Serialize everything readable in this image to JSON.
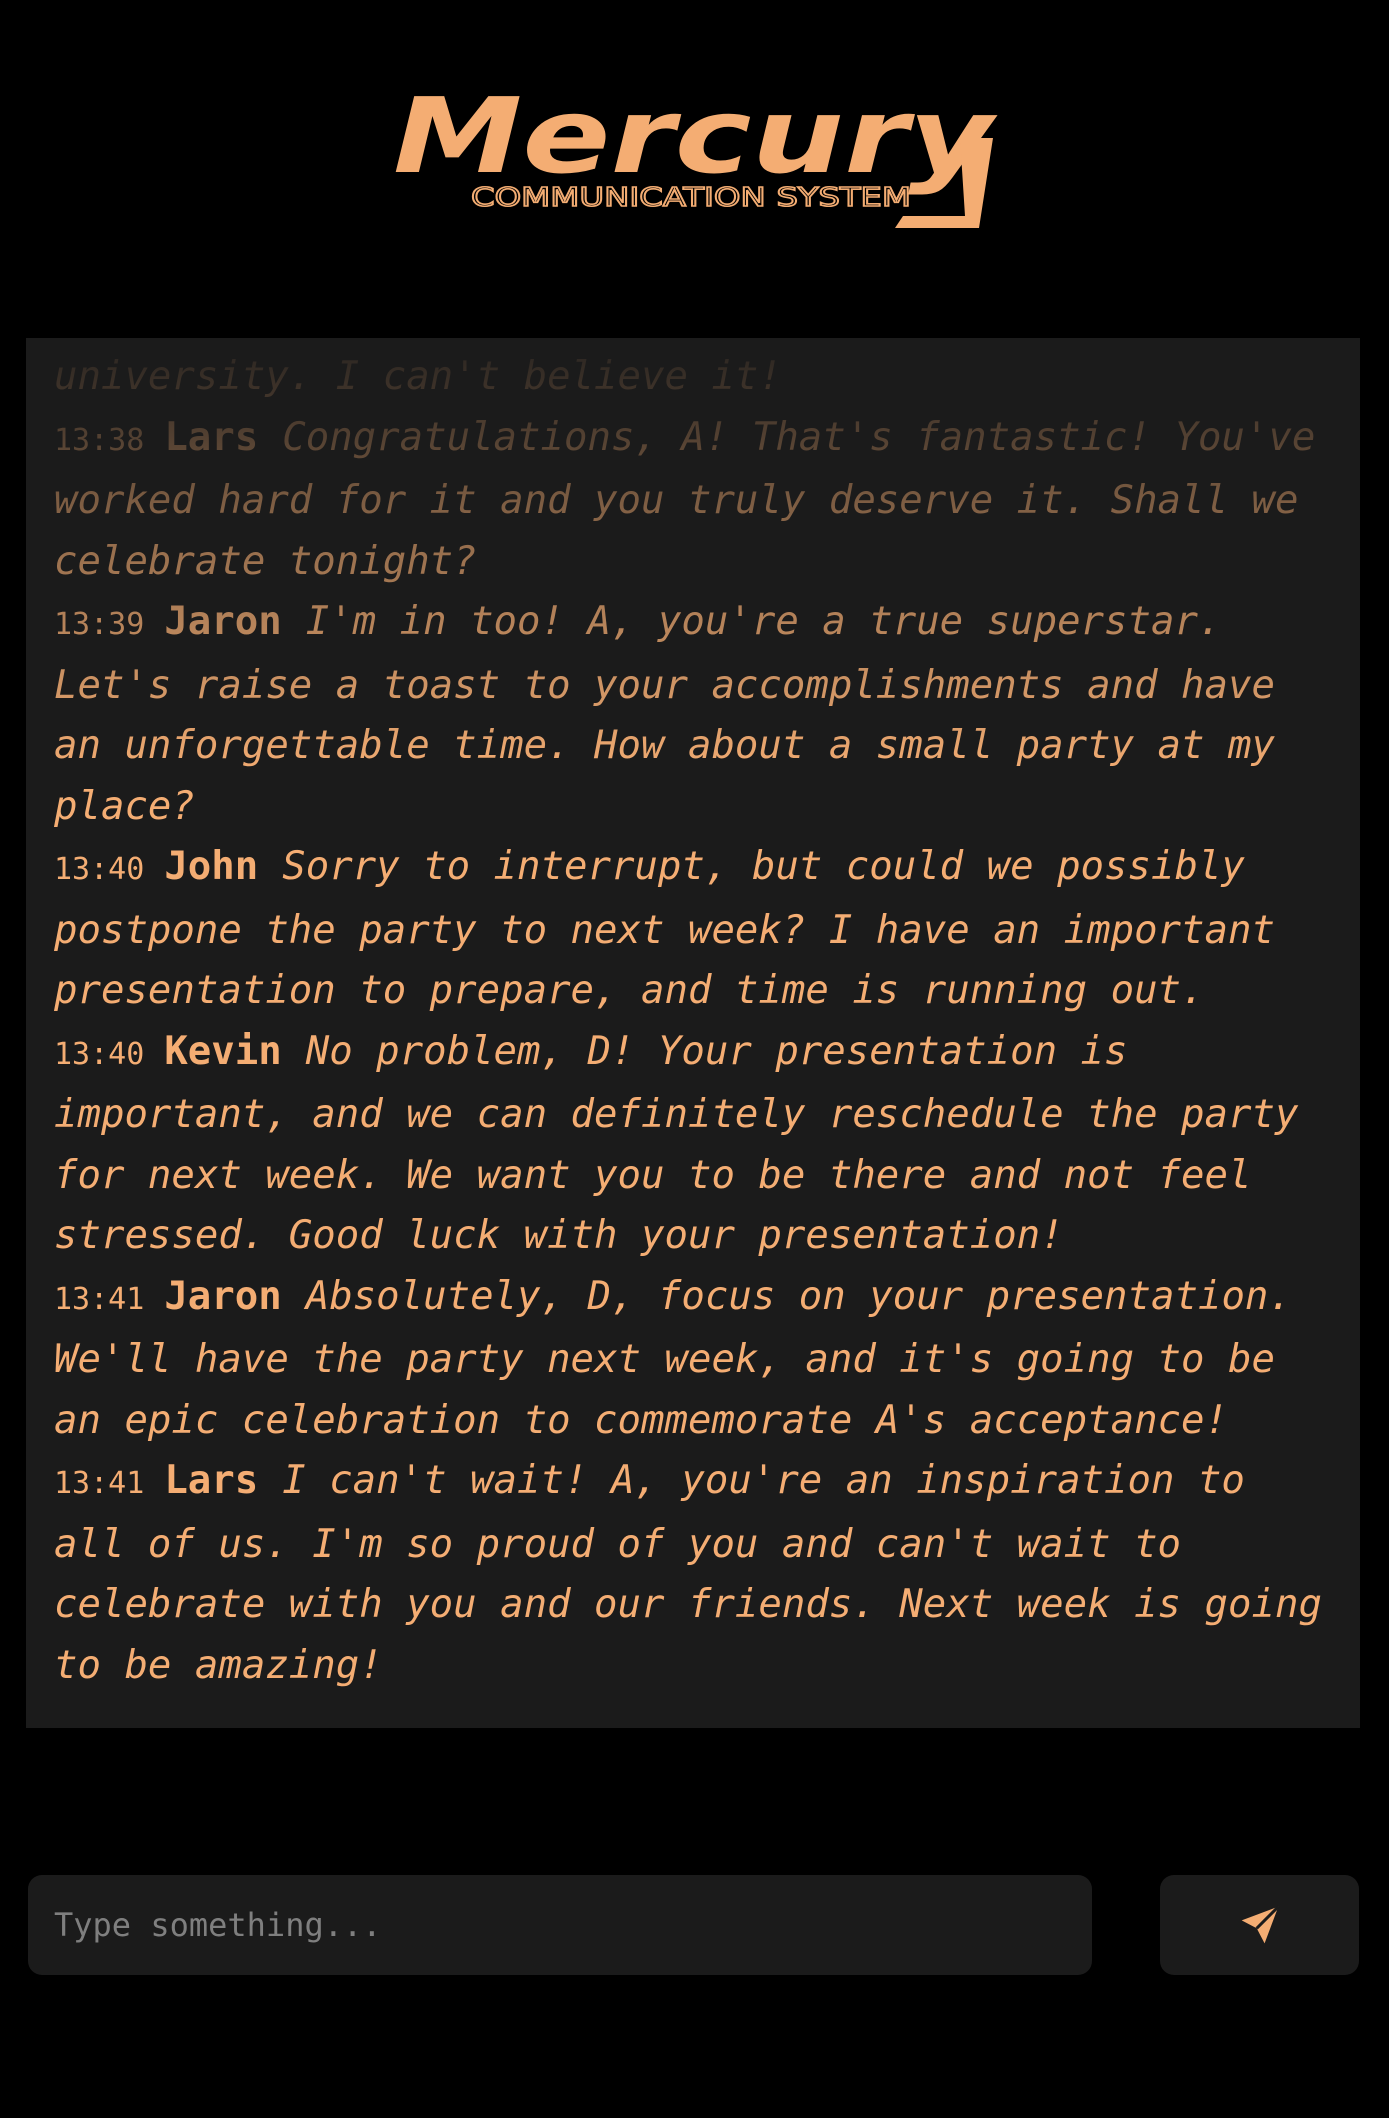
{
  "app": {
    "logo_title": "Mercury",
    "logo_subtitle": "COMMUNICATION SYSTEM"
  },
  "colors": {
    "accent": "#f4ad73",
    "background": "#000000",
    "panel": "#1b1b1b",
    "placeholder": "#7f7f7f"
  },
  "chat": {
    "messages": [
      {
        "time": "",
        "sender": "",
        "text": "received an acceptance letter from my dream university. I can't believe it!"
      },
      {
        "time": "13:38",
        "sender": "Lars",
        "text": "Congratulations, A! That's fantastic! You've worked hard for it and you truly deserve it. Shall we celebrate tonight?"
      },
      {
        "time": "13:39",
        "sender": "Jaron",
        "text": "I'm in too! A, you're a true superstar. Let's raise a toast to your accomplishments and have an unforgettable time. How about a small party at my place?"
      },
      {
        "time": "13:40",
        "sender": "John",
        "text": "Sorry to interrupt, but could we possibly postpone the party to next week? I have an important presentation to prepare, and time is running out."
      },
      {
        "time": "13:40",
        "sender": "Kevin",
        "text": "No problem, D! Your presentation is important, and we can definitely reschedule the party for next week. We want you to be there and not feel stressed. Good luck with your presentation!"
      },
      {
        "time": "13:41",
        "sender": "Jaron",
        "text": "Absolutely, D, focus on your presentation. We'll have the party next week, and it's going to be an epic celebration to commemorate A's acceptance!"
      },
      {
        "time": "13:41",
        "sender": "Lars",
        "text": "I can't wait! A, you're an inspiration to all of us. I'm so proud of you and can't wait to celebrate with you and our friends. Next week is going to be amazing!"
      }
    ]
  },
  "composer": {
    "placeholder": "Type something...",
    "value": "",
    "send_icon": "paper-plane-icon"
  }
}
